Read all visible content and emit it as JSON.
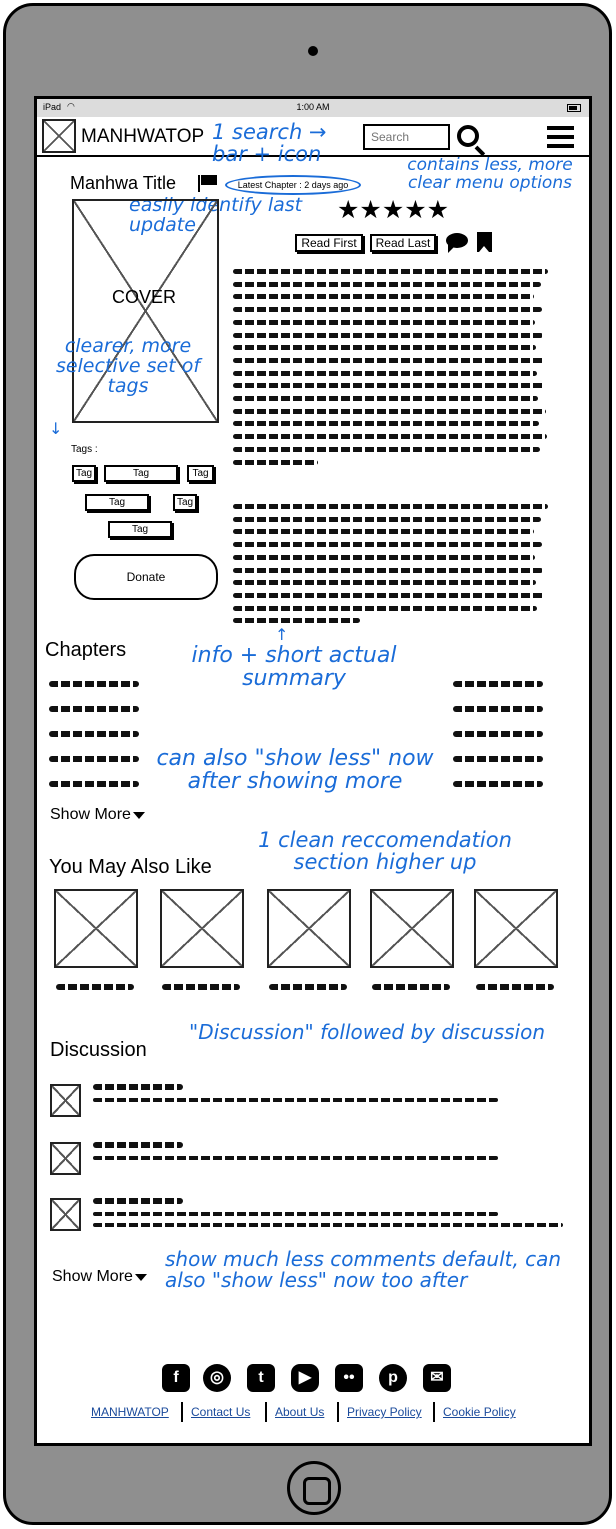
{
  "status_bar": {
    "device": "iPad",
    "time": "1:00 AM"
  },
  "header": {
    "brand": "MANHWATOP",
    "search_placeholder": "Search"
  },
  "manhwa": {
    "title": "Manhwa Title",
    "latest_chapter": "Latest Chapter : 2 days ago",
    "rating_stars": 5,
    "rating_glyphs": "★★★★★",
    "read_first": "Read First",
    "read_last": "Read Last",
    "cover_label": "COVER",
    "tags_label": "Tags :",
    "tags": [
      "Tag",
      "Tag",
      "Tag",
      "Tag",
      "Tag",
      "Tag"
    ],
    "donate": "Donate"
  },
  "sections": {
    "chapters": "Chapters",
    "show_more": "Show More",
    "recommendations": "You May Also Like",
    "discussion": "Discussion",
    "comments_show_more": "Show More"
  },
  "annotations": {
    "search": "1 search → bar + icon",
    "menu": "contains less, more clear menu options",
    "latest": "easily identify last update",
    "tags": "clearer, more selective set of tags",
    "summary": "info + short actual summary",
    "show_less": "can also \"show less\" now after showing more",
    "recommendation": "1 clean reccomendation section higher up",
    "discussion": "\"Discussion\" followed by discussion",
    "comments": "show much less comments default, can also \"show less\" now too after"
  },
  "footer": {
    "links": [
      "MANHWATOP",
      "Contact Us",
      "About Us",
      "Privacy Policy",
      "Cookie Policy"
    ],
    "social_icons": [
      "facebook-icon",
      "instagram-icon",
      "twitter-icon",
      "youtube-icon",
      "flickr-icon",
      "pinterest-icon",
      "email-icon"
    ]
  },
  "colors": {
    "annotation": "#1a6cd8",
    "device": "#8f8f8f",
    "link": "#1a4a9b"
  }
}
